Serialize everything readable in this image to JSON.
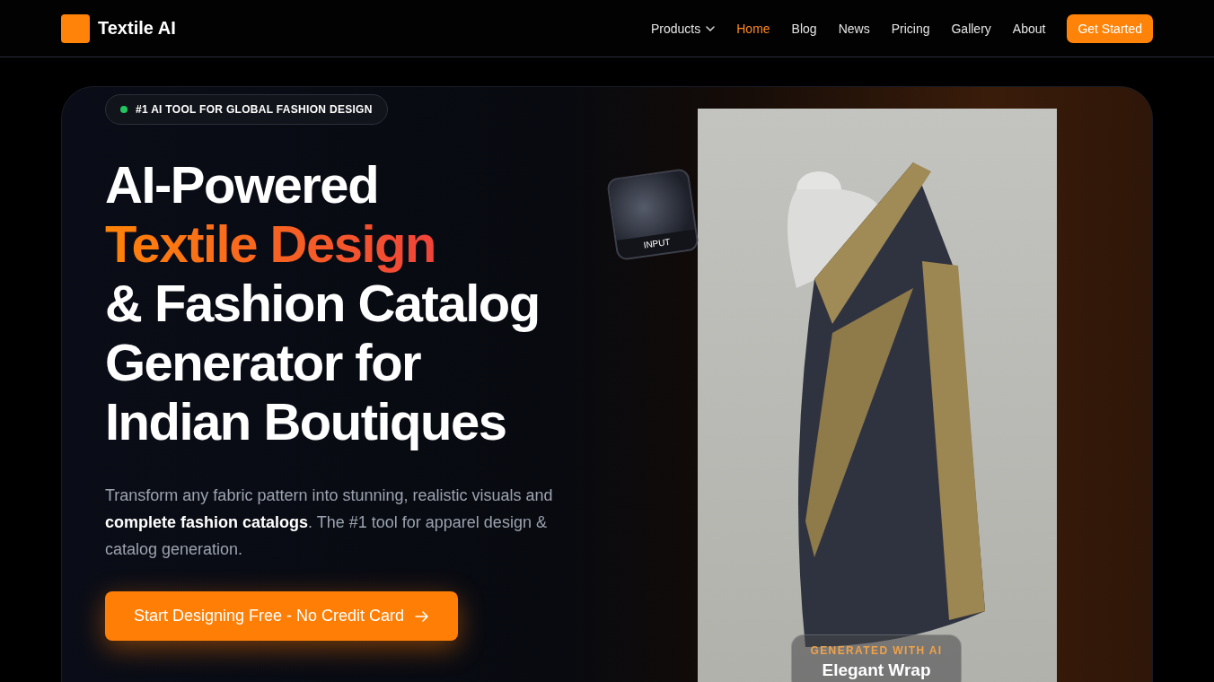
{
  "brand": {
    "name": "Textile AI"
  },
  "nav": [
    {
      "label": "Products",
      "kind": "dropdown",
      "selected": false
    },
    {
      "label": "Home",
      "kind": "link",
      "selected": true
    },
    {
      "label": "Blog",
      "kind": "link",
      "selected": false
    },
    {
      "label": "News",
      "kind": "link",
      "selected": false
    },
    {
      "label": "Pricing",
      "kind": "link",
      "selected": false
    },
    {
      "label": "Gallery",
      "kind": "link",
      "selected": false
    },
    {
      "label": "About",
      "kind": "link",
      "selected": false
    }
  ],
  "cta": "Get Started",
  "hero": {
    "badge": "#1 AI TOOL FOR GLOBAL FASHION DESIGN",
    "headline": [
      {
        "text": "AI-Powered",
        "highlight": false
      },
      {
        "text": "Textile Design",
        "highlight": true
      },
      {
        "text": "& Fashion Catalog",
        "highlight": false
      },
      {
        "text": "Generator for",
        "highlight": false
      },
      {
        "text": "Indian Boutiques",
        "highlight": false
      }
    ],
    "description": "Transform any fabric pattern into stunning, realistic visuals and **complete fashion catalogs**. The #1 tool for apparel design & catalog generation.",
    "button": "Start Designing Free - No Credit Card",
    "input_label": "INPUT",
    "caption": {
      "eyebrow": "GENERATED WITH AI",
      "title": "Elegant Wrap"
    }
  }
}
